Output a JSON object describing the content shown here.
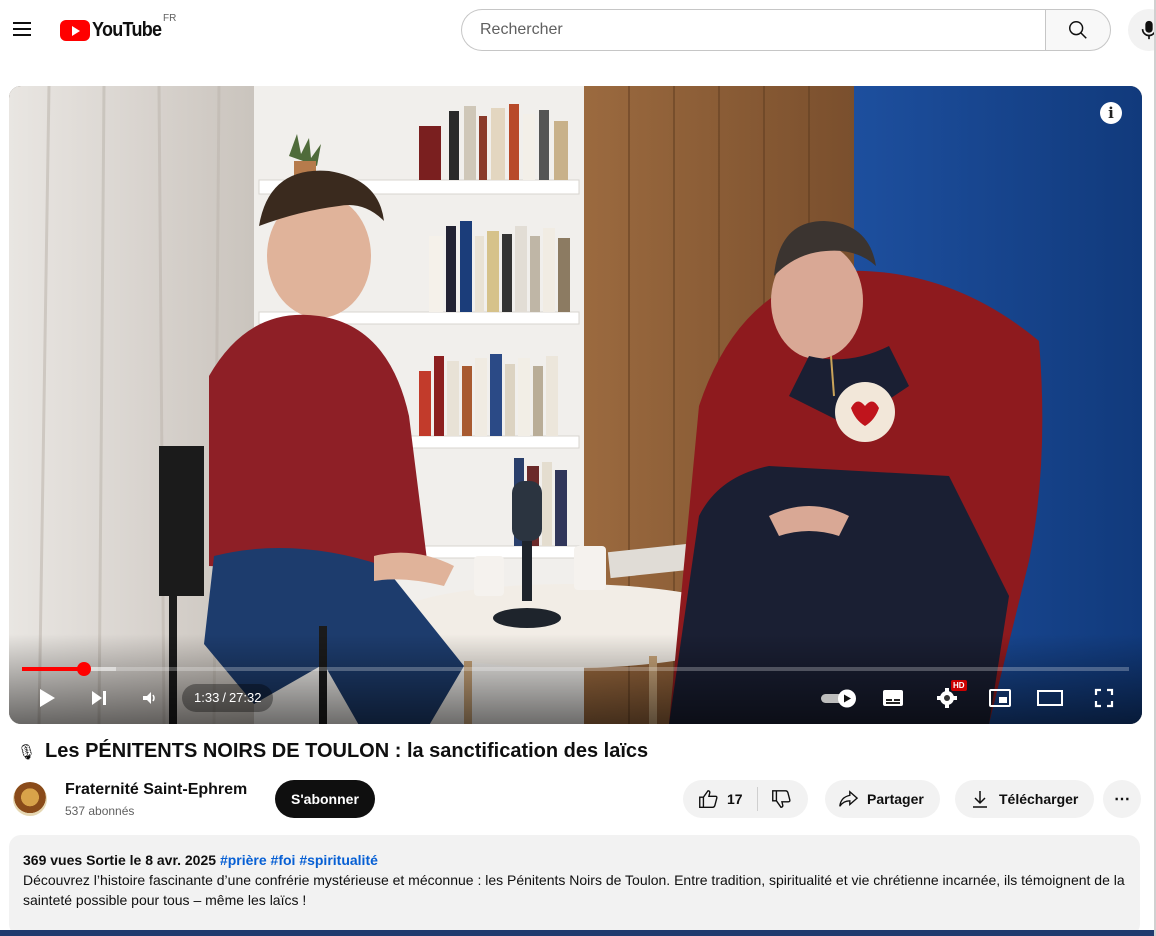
{
  "header": {
    "logo_text": "YouTube",
    "country_code": "FR",
    "search_placeholder": "Rechercher",
    "icons": [
      "menu-icon",
      "youtube-logo",
      "search-icon",
      "microphone-icon"
    ]
  },
  "player": {
    "current_time": "1:33",
    "duration": "27:32",
    "progress_fraction": 0.056,
    "buffered_fraction": 0.085,
    "icons": [
      "info-icon",
      "play-icon",
      "next-icon",
      "volume-icon",
      "autoplay-toggle-icon",
      "subtitles-icon",
      "settings-icon",
      "hd-badge",
      "miniplayer-icon",
      "theater-icon",
      "fullscreen-icon"
    ],
    "hd_label": "HD"
  },
  "video": {
    "title_emoji": "🎙",
    "title": "Les PÉNITENTS NOIRS DE TOULON : la sanctification des laïcs"
  },
  "channel": {
    "name": "Fraternité Saint-Ephrem",
    "subscribers": "537 abonnés",
    "subscribe_label": "S'abonner"
  },
  "actions": {
    "likes": "17",
    "share_label": "Partager",
    "download_label": "Télécharger",
    "more_label": "⋯"
  },
  "description": {
    "views": "369 vues",
    "date": "Sortie le 8 avr. 2025",
    "tags": [
      "#prière",
      "#foi",
      "#spiritualité"
    ],
    "text": "Découvrez l’histoire fascinante d’une confrérie mystérieuse et méconnue : les Pénitents Noirs de Toulon. Entre tradition, spiritualité et vie chrétienne incarnée, ils témoignent de la sainteté possible pour tous – même les laïcs !"
  },
  "colors": {
    "accent": "#ff0000",
    "link": "#065fd4",
    "text": "#0f0f0f",
    "secondary": "#606060"
  }
}
